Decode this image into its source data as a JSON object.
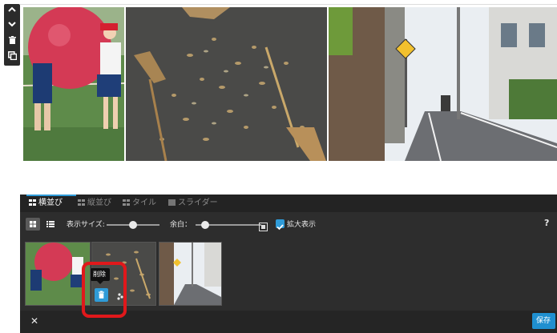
{
  "colors": {
    "panel_bg": "#2d2d2d",
    "accent_blue": "#2f9bd8",
    "highlight_red": "#e0181b",
    "save_bg": "#1f8fd0"
  },
  "toolbar": {
    "icons": [
      "chevron-up-icon",
      "chevron-down-icon",
      "trash-icon",
      "duplicate-icon"
    ]
  },
  "tabs": [
    {
      "label": "横並び",
      "icon": "grid-icon",
      "active": true
    },
    {
      "label": "縦並び",
      "icon": "grid-icon",
      "active": false
    },
    {
      "label": "タイル",
      "icon": "grid-icon",
      "active": false
    },
    {
      "label": "スライダー",
      "icon": "slideshow-icon",
      "active": false
    }
  ],
  "settings": {
    "display_size_label": "表示サイズ:",
    "display_size_level": 0.5,
    "margin_label": "余白：",
    "margin_level": 0.15,
    "enlarge_label": "拡大表示",
    "enlarge_checked": true,
    "help_label": "?"
  },
  "thumbnails": [
    {
      "alt": "balloon race"
    },
    {
      "alt": "leaves and broom"
    },
    {
      "alt": "street with sign"
    }
  ],
  "tooltip": {
    "text": "削除"
  },
  "footer": {
    "close_label": "✕",
    "save_label": "保存"
  }
}
